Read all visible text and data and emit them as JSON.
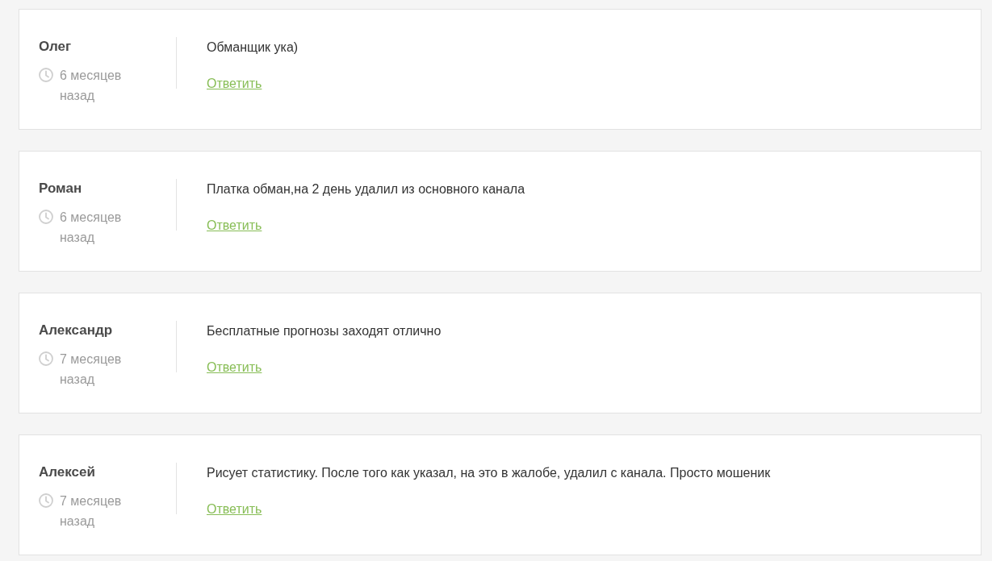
{
  "comments": [
    {
      "author": "Олег",
      "time": "6 месяцев назад",
      "text": "Обманщик ука)",
      "reply_link": "Ответить"
    },
    {
      "author": "Роман",
      "time": "6 месяцев назад",
      "text": "Платка обман,на 2 день удалил из основного канала",
      "reply_link": "Ответить"
    },
    {
      "author": "Александр",
      "time": "7 месяцев назад",
      "text": "Бесплатные прогнозы заходят отлично",
      "reply_link": "Ответить"
    },
    {
      "author": "Алексей",
      "time": "7 месяцев назад",
      "text": "Рисует статистику. После того как указал, на это в жалобе, удалил с канала. Просто мошеник",
      "reply_link": "Ответить"
    }
  ]
}
